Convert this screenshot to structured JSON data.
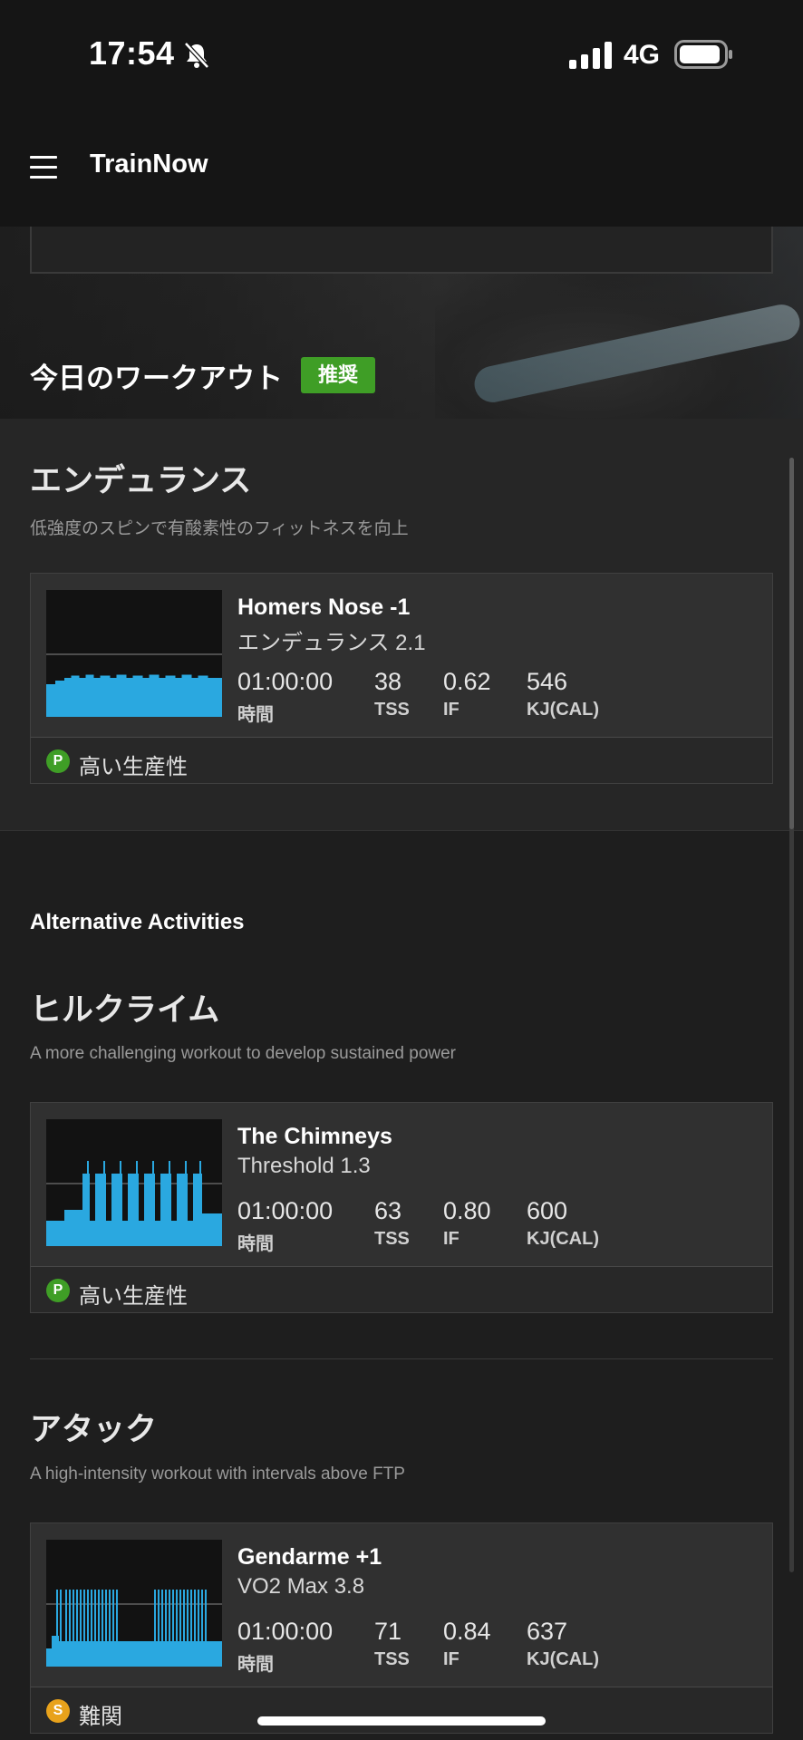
{
  "status_bar": {
    "time": "17:54",
    "network": "4G"
  },
  "app_bar": {
    "title": "TrainNow"
  },
  "today": {
    "heading": "今日のワークアウト",
    "badge": "推奨"
  },
  "sections": [
    {
      "category": "エンデュランス",
      "description": "低強度のスピンで有酸素性のフィットネスを向上",
      "workout": {
        "name": "Homers Nose -1",
        "subtitle": "エンデュランス 2.1",
        "stats": {
          "time": "01:00:00",
          "tss": "38",
          "if": "0.62",
          "kj": "546"
        },
        "labels": {
          "time": "時間",
          "tss": "TSS",
          "if": "IF",
          "kj": "KJ(CAL)"
        },
        "badge_letter": "P",
        "badge_text": "高い生産性",
        "badge_color": "#3f9e26"
      }
    },
    {
      "category": "ヒルクライム",
      "description": "A more challenging workout to develop sustained power",
      "workout": {
        "name": "The Chimneys",
        "subtitle": "Threshold 1.3",
        "stats": {
          "time": "01:00:00",
          "tss": "63",
          "if": "0.80",
          "kj": "600"
        },
        "labels": {
          "time": "時間",
          "tss": "TSS",
          "if": "IF",
          "kj": "KJ(CAL)"
        },
        "badge_letter": "P",
        "badge_text": "高い生産性",
        "badge_color": "#3f9e26"
      }
    },
    {
      "category": "アタック",
      "description": "A high-intensity workout with intervals above FTP",
      "workout": {
        "name": "Gendarme +1",
        "subtitle": "VO2 Max 3.8",
        "stats": {
          "time": "01:00:00",
          "tss": "71",
          "if": "0.84",
          "kj": "637"
        },
        "labels": {
          "time": "時間",
          "tss": "TSS",
          "if": "IF",
          "kj": "KJ(CAL)"
        },
        "badge_letter": "S",
        "badge_text": "難関",
        "badge_color": "#e8a21b"
      }
    }
  ],
  "alternatives": {
    "heading": "Alternative Activities"
  },
  "colors": {
    "accent_green": "#3f9e26",
    "graph_blue": "#2aa8e0",
    "warning_yellow": "#e8a21b"
  }
}
